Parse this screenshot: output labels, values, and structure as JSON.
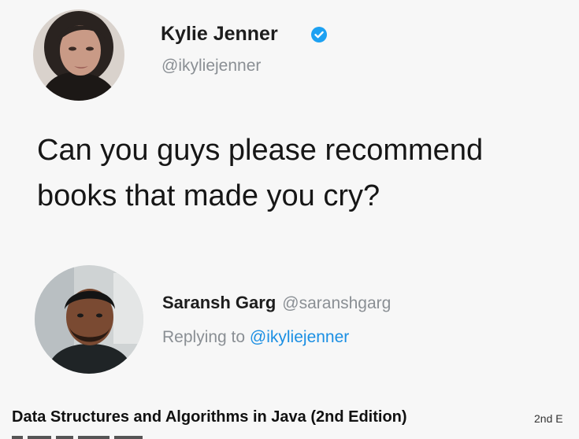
{
  "tweet": {
    "author": {
      "name": "Kylie Jenner",
      "handle": "@ikyliejenner",
      "verified": true,
      "avatar_icon": "profile-photo"
    },
    "text_lines": [
      "Can you guys please recommend",
      "books that made you cry?"
    ]
  },
  "reply": {
    "author": {
      "name": "Saransh Garg",
      "handle": "@saranshgarg",
      "avatar_icon": "profile-photo"
    },
    "replying_prefix": "Replying to",
    "replying_to": "@ikyliejenner"
  },
  "book": {
    "title": "Data Structures and Algorithms in Java (2nd Edition)",
    "edition_fragment": "2nd E"
  },
  "colors": {
    "background": "#f7f7f7",
    "verified_blue": "#1da1f2",
    "link_blue": "#1b8fe3",
    "secondary_text": "#8a8f94"
  }
}
